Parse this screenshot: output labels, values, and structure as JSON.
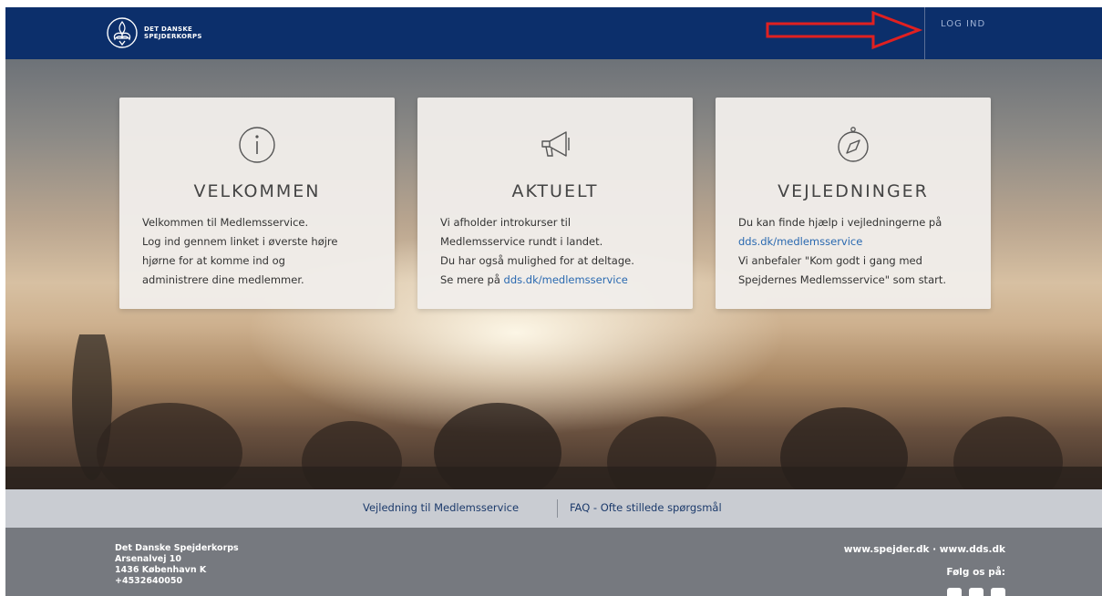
{
  "header": {
    "logo_line1": "DET DANSKE",
    "logo_line2": "SPEJDERKORPS",
    "login_label": "LOG IND",
    "background_color": "#0c2f6b"
  },
  "annotation": {
    "arrow_color": "#e02020",
    "arrow_icon": "red-arrow-right"
  },
  "cards": [
    {
      "icon": "info-icon",
      "title": "VELKOMMEN",
      "lines": [
        "Velkommen til Medlemsservice.",
        "Log ind gennem linket i øverste højre",
        "hjørne for at komme ind og",
        "administrere dine medlemmer."
      ]
    },
    {
      "icon": "megaphone-icon",
      "title": "AKTUELT",
      "lines": [
        "Vi afholder introkurser til",
        "Medlemsservice rundt i landet.",
        "Du har også mulighed for at deltage.",
        "Se mere på "
      ],
      "link": "dds.dk/medlemsservice"
    },
    {
      "icon": "compass-icon",
      "title": "VEJLEDNINGER",
      "lines": [
        "Du kan finde hjælp i vejledningerne på",
        "Vi anbefaler \"Kom godt i gang med",
        "Spejdernes Medlemsservice\" som start."
      ],
      "link": "dds.dk/medlemsservice"
    }
  ],
  "linkbar": {
    "link1": "Vejledning til Medlemsservice",
    "link2": "FAQ - Ofte stillede spørgsmål"
  },
  "footer": {
    "org": "Det Danske Spejderkorps",
    "street": "Arsenalvej 10",
    "city": "1436 København K",
    "phone": "+4532640050",
    "sites": "www.spejder.dk · www.dds.dk",
    "follow": "Følg os på:",
    "social_icons": [
      "youtube-icon",
      "instagram-icon",
      "facebook-icon"
    ]
  }
}
